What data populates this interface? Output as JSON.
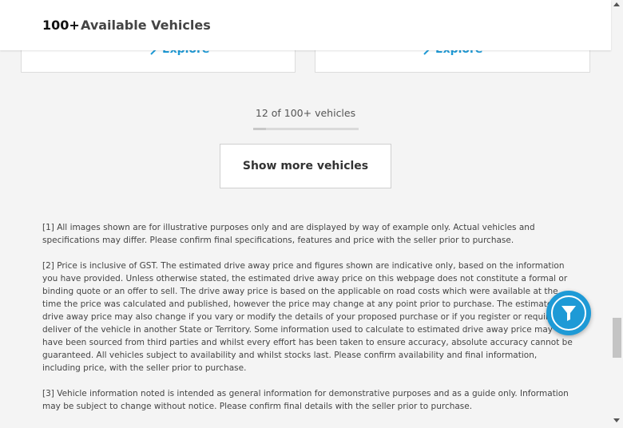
{
  "header": {
    "count": "100+",
    "label": "Available Vehicles"
  },
  "cards": [
    {
      "explore_label": "Explore"
    },
    {
      "explore_label": "Explore"
    }
  ],
  "pagination": {
    "counter_text": "12 of 100+ vehicles",
    "progress_fraction": 0.12,
    "show_more_label": "Show more vehicles"
  },
  "disclaimers": [
    "[1] All images shown are for illustrative purposes only and are displayed by way of example only. Actual vehicles and specifications may differ. Please confirm final specifications, features and price with the seller prior to purchase.",
    "[2] Price is inclusive of GST. The estimated drive away price and figures shown are indicative only, based on the information you have provided. Unless otherwise stated, the estimated drive away price on this webpage does not constitute a formal or binding quote or an offer to sell. The drive away price is based on the applicable on road costs which were available at the time the price was calculated and published, however the price may change at any point prior to purchase. The estimated drive away price may also change if you vary or modify the details of your proposed purchase or if you register or require deliver of the vehicle in another State or Territory. Some information used to calculate to estimated drive away price may have been sourced from third parties and whilst every effort has been taken to ensure accuracy, absolute accuracy cannot be guaranteed. All vehicles subject to availability and whilst stocks last. Please confirm availability and final information, including price, with the seller prior to purchase.",
    "[3] Vehicle information noted is intended as general information for demonstrative purposes and as a guide only. Information may be subject to change without notice. Please confirm final details with the seller prior to purchase."
  ],
  "filter_button": {
    "icon": "filter-icon",
    "color": "#1e9ad6"
  },
  "colors": {
    "accent": "#1f9bd7",
    "background": "#f4f4f4"
  }
}
